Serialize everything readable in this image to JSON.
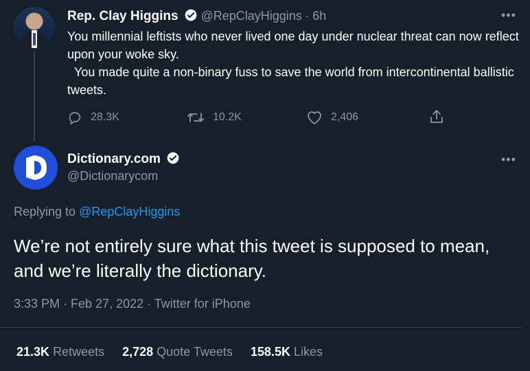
{
  "tweet1": {
    "author_name": "Rep. Clay Higgins",
    "handle": "@RepClayHiggins",
    "time": "· 6h",
    "more": "•••",
    "text": "You millennial leftists who never lived one day under nuclear threat can now reflect upon your woke sky.\n  You made quite a non-binary fuss to save the world from intercontinental ballistic tweets.",
    "reply_count": "28.3K",
    "retweet_count": "10.2K",
    "like_count": "2,406"
  },
  "tweet2": {
    "author_name": "Dictionary.com",
    "handle": "@Dictionarycom",
    "more": "•••",
    "replying_prefix": "Replying to",
    "replying_to": "@RepClayHiggins",
    "text": "We’re not entirely sure what this tweet is supposed to mean, and we’re literally the dictionary.",
    "timestamp": "3:33 PM · Feb 27, 2022 · Twitter for iPhone",
    "stats": {
      "retweets_count": "21.3K",
      "retweets_label": "Retweets",
      "quotes_count": "2,728",
      "quotes_label": "Quote Tweets",
      "likes_count": "158.5K",
      "likes_label": "Likes"
    }
  },
  "colors": {
    "background": "#15202b",
    "accent": "#1d9bf0",
    "muted": "#8b98a5",
    "divider": "#38444d"
  }
}
